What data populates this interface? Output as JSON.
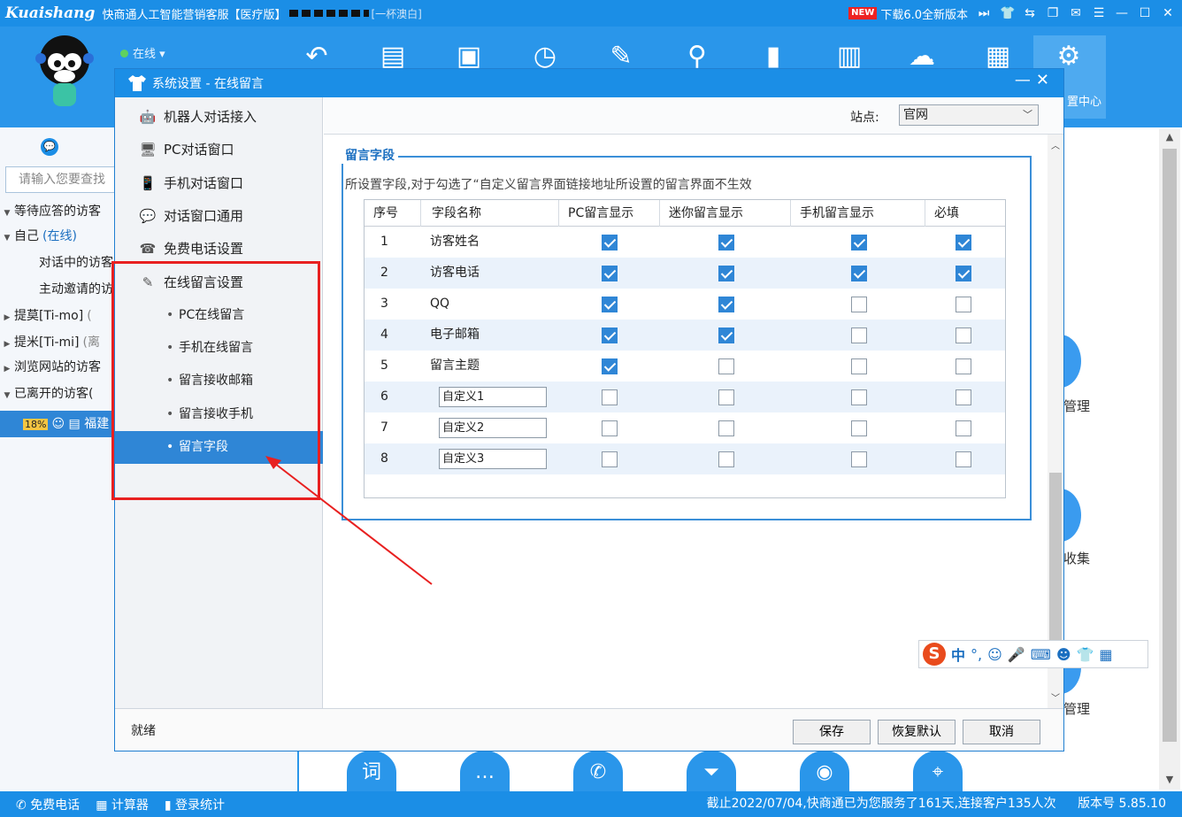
{
  "app": {
    "brand": "Kuaishang",
    "title": "快商通人工智能营销客服【医疗版】",
    "title_tail": "[一杯澳白]",
    "new_badge": "NEW",
    "download_text": "下载6.0全新版本",
    "status_text": "在线",
    "settings_center_label": "置中心"
  },
  "sidebar": {
    "search_placeholder": "请输入您要查找",
    "rows": [
      {
        "text": "等待应答的访客",
        "expanded": true
      },
      {
        "text": "自己",
        "suffix": "(在线)",
        "expanded": true
      },
      {
        "text": "对话中的访客",
        "child": true
      },
      {
        "text": "主动邀请的访",
        "child": true
      },
      {
        "text": "提莫[Ti-mo]",
        "suffix": "(",
        "expanded": false
      },
      {
        "text": "提米[Ti-mi]",
        "suffix": "(离",
        "expanded": false
      },
      {
        "text": "浏览网站的访客",
        "expanded": false
      },
      {
        "text": "已离开的访客(",
        "expanded": true
      }
    ],
    "visitor_row": {
      "pct": "18%",
      "name": "福建"
    }
  },
  "right_panel": {
    "labels": [
      "管理",
      "收集",
      "管理"
    ]
  },
  "footer": {
    "items": [
      "免费电话",
      "计算器",
      "登录统计"
    ],
    "right_text": "截止2022/07/04,快商通已为您服务了161天,连接客户135人次",
    "version": "版本号 5.85.10"
  },
  "dialog": {
    "title": "系统设置 - 在线留言",
    "nav": [
      {
        "label": "机器人对话接入",
        "icon": "robot-icon",
        "sub": false
      },
      {
        "label": "PC对话窗口",
        "icon": "monitor-icon",
        "sub": false
      },
      {
        "label": "手机对话窗口",
        "icon": "phone-icon",
        "sub": false
      },
      {
        "label": "对话窗口通用",
        "icon": "chat-icon",
        "sub": false
      },
      {
        "label": "免费电话设置",
        "icon": "telephone-icon",
        "sub": false
      },
      {
        "label": "在线留言设置",
        "icon": "edit-icon",
        "sub": false
      },
      {
        "label": "PC在线留言",
        "sub": true
      },
      {
        "label": "手机在线留言",
        "sub": true
      },
      {
        "label": "留言接收邮箱",
        "sub": true
      },
      {
        "label": "留言接收手机",
        "sub": true
      },
      {
        "label": "留言字段",
        "sub": true,
        "selected": true
      }
    ],
    "site_label": "站点:",
    "site_value": "官网",
    "group_title": "留言字段",
    "group_desc": "所设置字段,对于勾选了“自定义留言界面链接地址所设置的留言界面不生效",
    "columns": [
      "序号",
      "字段名称",
      "PC留言显示",
      "迷你留言显示",
      "手机留言显示",
      "必填"
    ],
    "rows": [
      {
        "no": "1",
        "name": "访客姓名",
        "custom": false,
        "pc": true,
        "mini": true,
        "mobile": true,
        "required": true
      },
      {
        "no": "2",
        "name": "访客电话",
        "custom": false,
        "pc": true,
        "mini": true,
        "mobile": true,
        "required": true
      },
      {
        "no": "3",
        "name": "QQ",
        "custom": false,
        "pc": true,
        "mini": true,
        "mobile": false,
        "required": false
      },
      {
        "no": "4",
        "name": "电子邮箱",
        "custom": false,
        "pc": true,
        "mini": true,
        "mobile": false,
        "required": false
      },
      {
        "no": "5",
        "name": "留言主题",
        "custom": false,
        "pc": true,
        "mini": false,
        "mobile": false,
        "required": false
      },
      {
        "no": "6",
        "name": "自定义1",
        "custom": true,
        "pc": false,
        "mini": false,
        "mobile": false,
        "required": false
      },
      {
        "no": "7",
        "name": "自定义2",
        "custom": true,
        "pc": false,
        "mini": false,
        "mobile": false,
        "required": false
      },
      {
        "no": "8",
        "name": "自定义3",
        "custom": true,
        "pc": false,
        "mini": false,
        "mobile": false,
        "required": false
      }
    ],
    "status_text": "就绪",
    "buttons": {
      "save": "保存",
      "restore": "恢复默认",
      "cancel": "取消"
    }
  },
  "ime": {
    "zh": "中",
    "punct": "°,"
  },
  "colors": {
    "brand_blue": "#1b8ee6",
    "selection_blue": "#2f86d6",
    "annotation_red": "#e82020"
  }
}
